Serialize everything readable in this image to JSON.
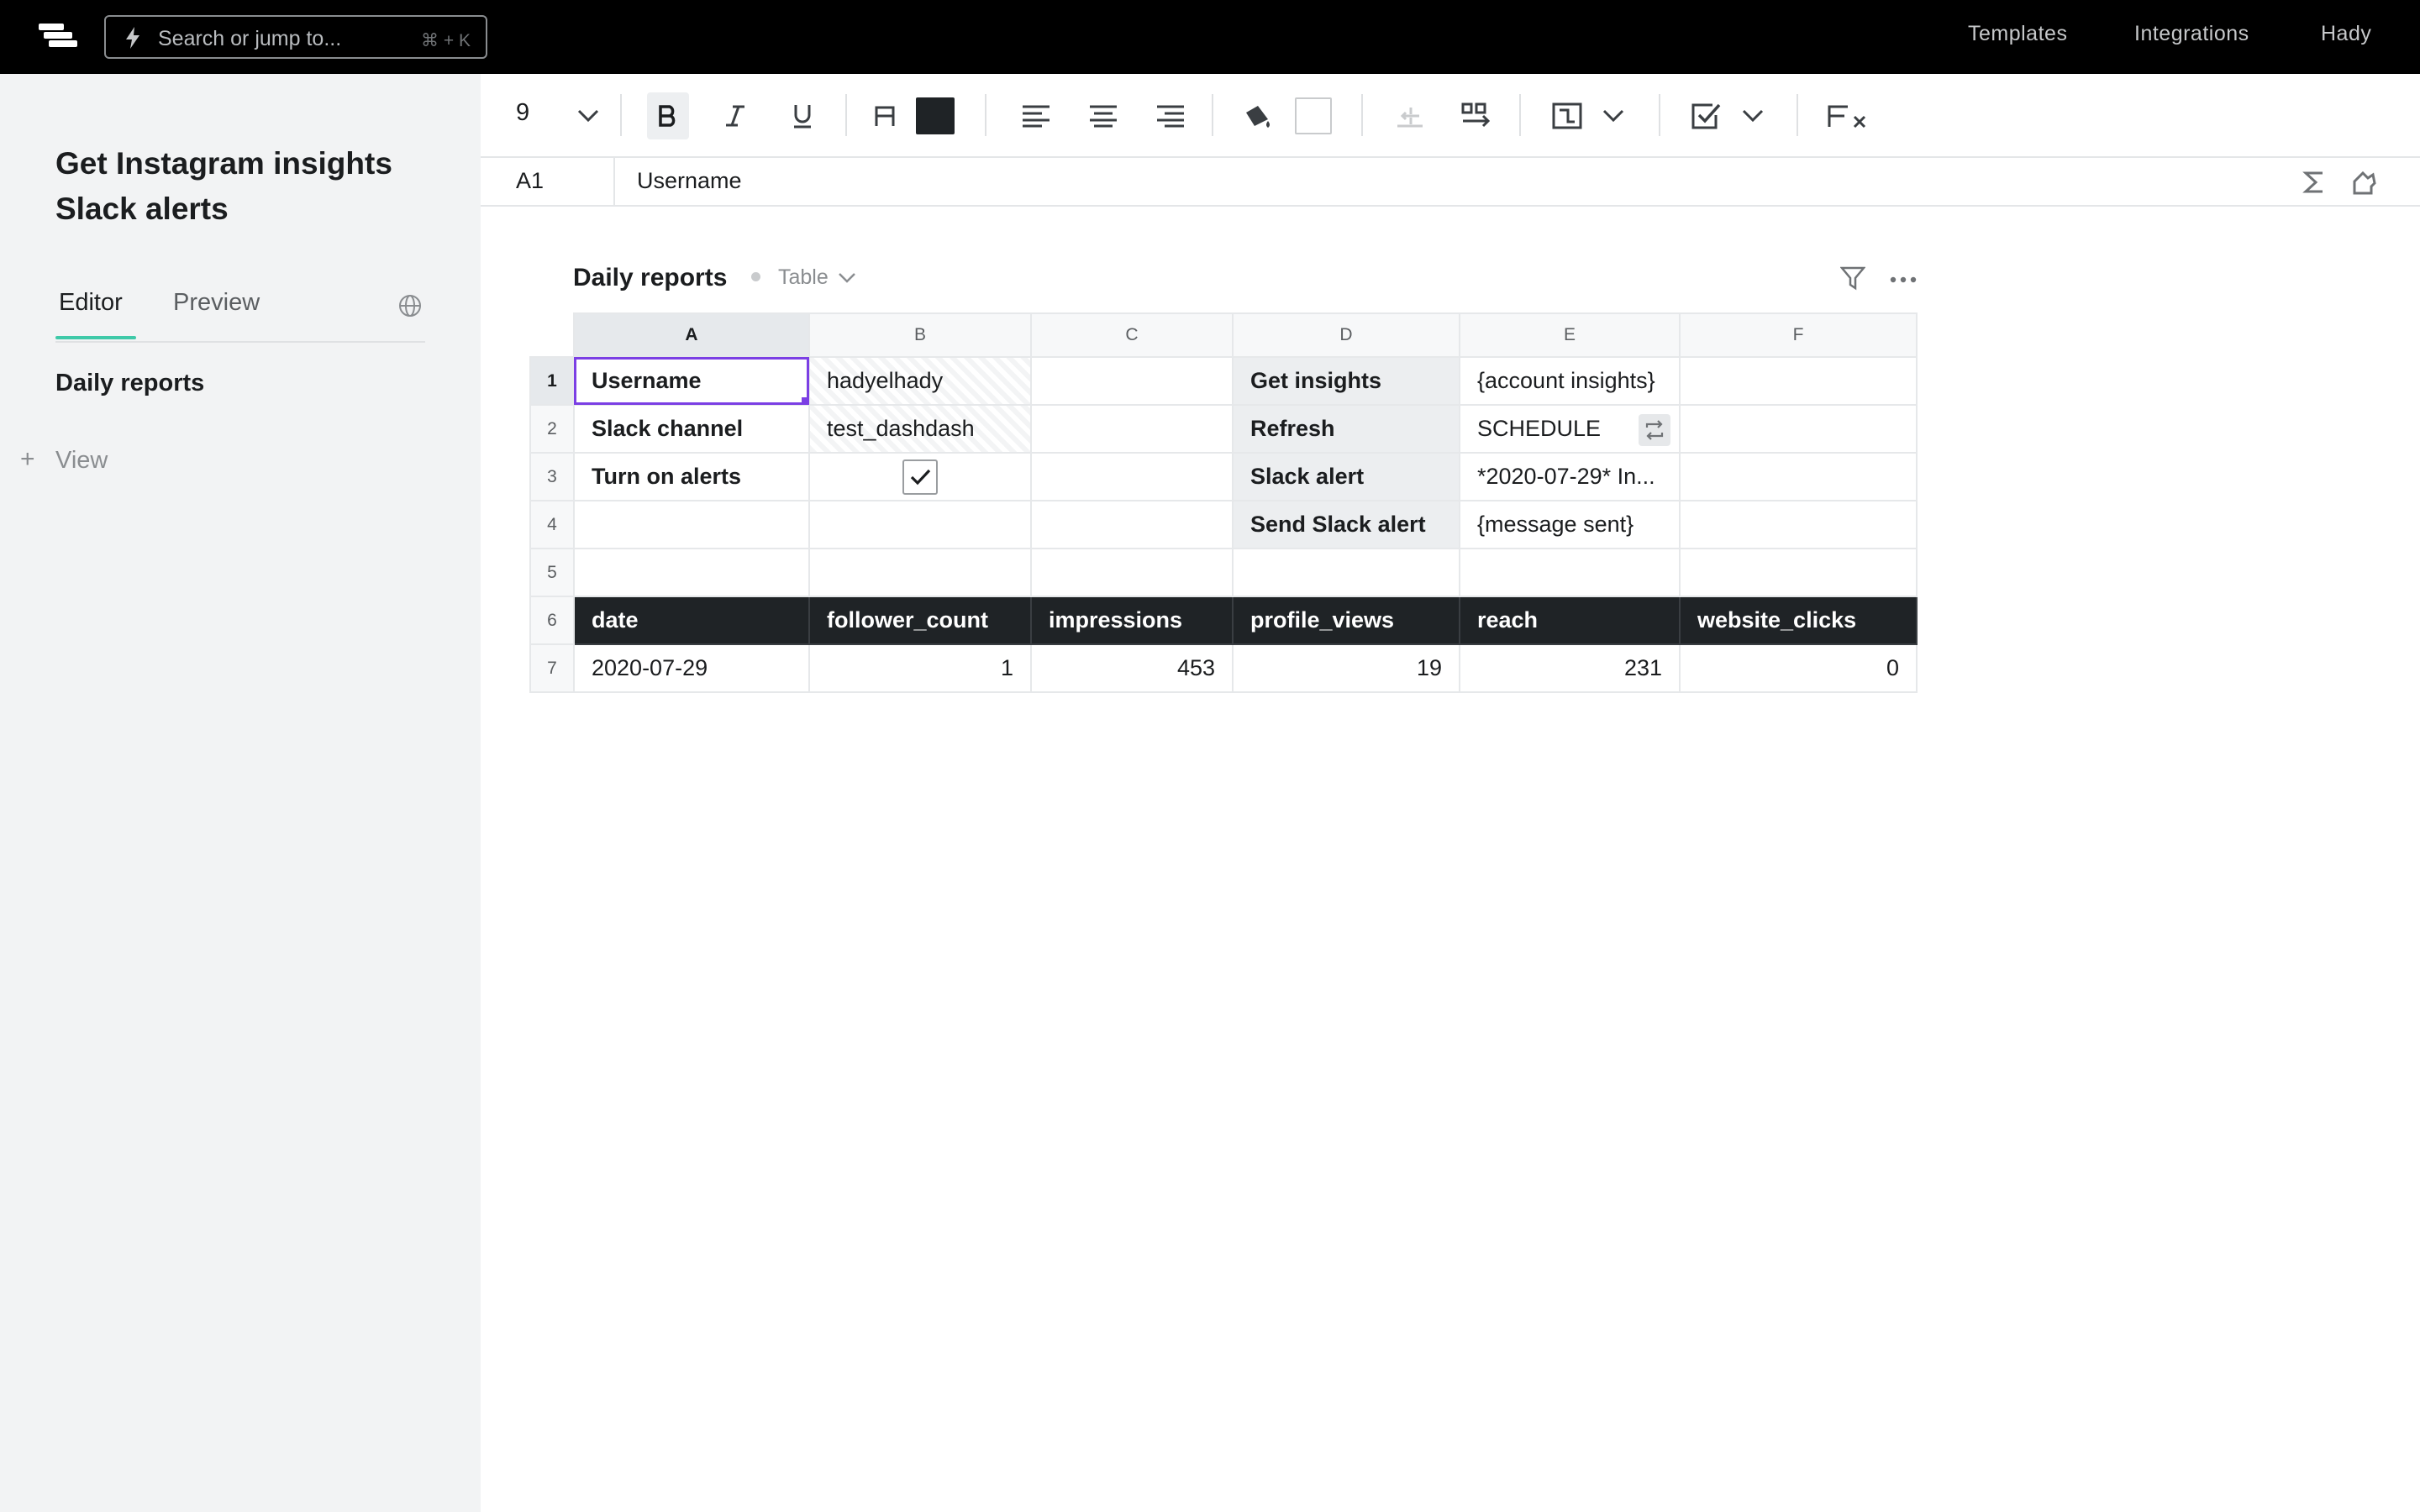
{
  "topbar": {
    "search_placeholder": "Search or jump to...",
    "search_shortcut": "⌘ + K",
    "nav": [
      "Templates",
      "Integrations",
      "Hady"
    ]
  },
  "sidebar": {
    "title_line1": "Get Instagram insights",
    "title_line2": "Slack alerts",
    "tabs": [
      "Editor",
      "Preview"
    ],
    "active_tab": "Editor",
    "section": "Daily reports",
    "add_view_label": "View"
  },
  "toolbar": {
    "font_size": "9",
    "text_color": "#1f2326",
    "fill_color": "#ffffff"
  },
  "formula_bar": {
    "cell_ref": "A1",
    "value": "Username"
  },
  "table": {
    "title": "Daily reports",
    "view_type": "Table",
    "columns": [
      "A",
      "B",
      "C",
      "D",
      "E",
      "F"
    ],
    "selected_column": "A",
    "rows": [
      {
        "num": "1",
        "a": "Username",
        "b": "hadyelhady",
        "c": "",
        "d": "Get insights",
        "e": "{account insights}",
        "f": ""
      },
      {
        "num": "2",
        "a": "Slack channel",
        "b": "test_dashdash",
        "c": "",
        "d": "Refresh",
        "e": "SCHEDULE",
        "f": ""
      },
      {
        "num": "3",
        "a": "Turn on alerts",
        "b_checked": true,
        "c": "",
        "d": "Slack alert",
        "e": "*2020-07-29* In...",
        "f": ""
      },
      {
        "num": "4",
        "a": "",
        "b": "",
        "c": "",
        "d": "Send Slack alert",
        "e": "{message sent}",
        "f": ""
      },
      {
        "num": "5",
        "a": "",
        "b": "",
        "c": "",
        "d": "",
        "e": "",
        "f": ""
      }
    ],
    "data_header": {
      "num": "6",
      "cells": [
        "date",
        "follower_count",
        "impressions",
        "profile_views",
        "reach",
        "website_clicks"
      ]
    },
    "data_row": {
      "num": "7",
      "cells": [
        "2020-07-29",
        "1",
        "453",
        "19",
        "231",
        "0"
      ]
    }
  }
}
